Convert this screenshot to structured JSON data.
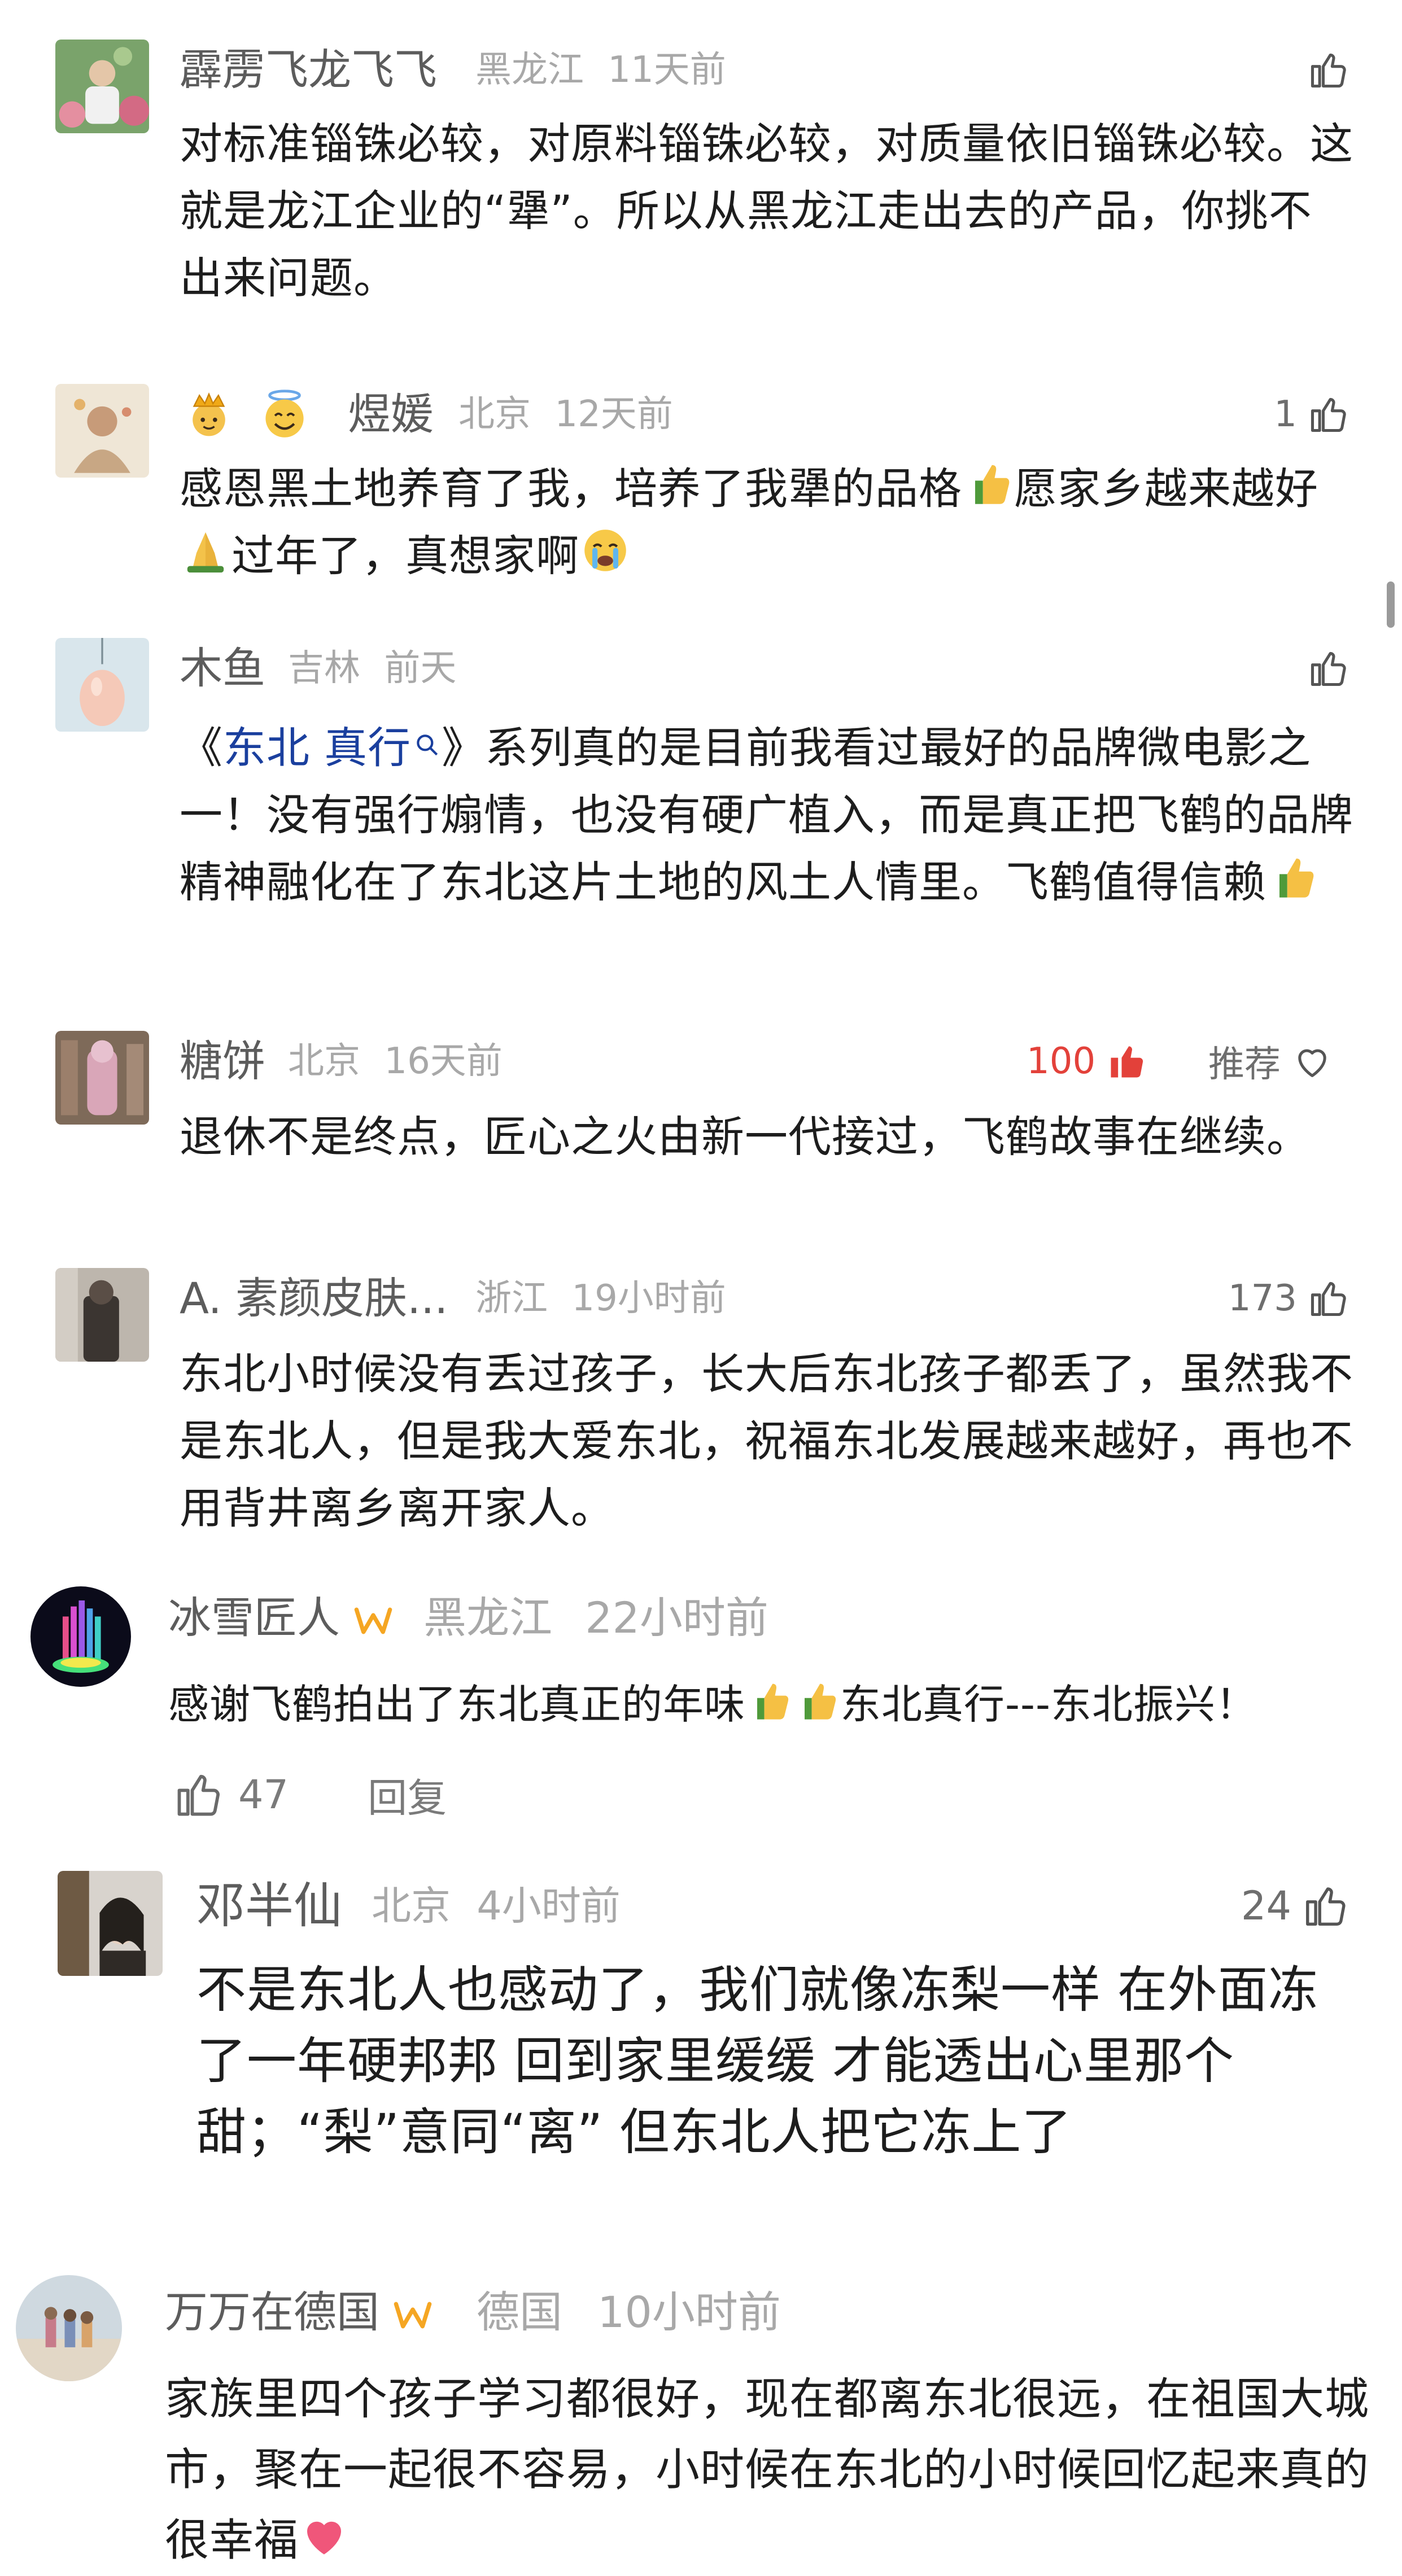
{
  "comments": [
    {
      "name": "霹雳飞龙飞飞",
      "location": "黑龙江",
      "time": "11天前",
      "likes": "",
      "text": "对标准锱铢必较，对原料锱铢必较，对质量依旧锱铢必较。这就是龙江企业的“犟”。所以从黑龙江走出去的产品，你挑不出来问题。"
    },
    {
      "name": "煜媛",
      "location": "北京",
      "time": "12天前",
      "likes": "1",
      "text_a": "感恩黑土地养育了我，培养了我犟的品格",
      "text_b": "愿家乡越来越好",
      "text_c": "过年了，真想家啊"
    },
    {
      "name": "木鱼",
      "location": "吉林",
      "time": "前天",
      "likes": "",
      "quote_open": "《",
      "hashtag": "东北 真行",
      "quote_close": "》",
      "text": "系列真的是目前我看过最好的品牌微电影之一！没有强行煽情，也没有硬广植入，而是真正把飞鹤的品牌精神融化在了东北这片土地的风土人情里。飞鹤值得信赖"
    },
    {
      "name": "糖饼",
      "location": "北京",
      "time": "16天前",
      "likes": "100",
      "recommend": "推荐",
      "text": "退休不是终点，匠心之火由新一代接过，飞鹤故事在继续。"
    },
    {
      "name": "A. 素颜皮肤...",
      "location": "浙江",
      "time": "19小时前",
      "likes": "173",
      "text": "东北小时候没有丢过孩子，长大后东北孩子都丢了，虽然我不是东北人，但是我大爱东北，祝福东北发展越来越好，再也不用背井离乡离开家人。"
    },
    {
      "name": "冰雪匠人",
      "location": "黑龙江",
      "time": "22小时前",
      "text_a": "感谢飞鹤拍出了东北真正的年味",
      "text_b": "东北真行---东北振兴！",
      "likes": "47",
      "reply": "回复"
    },
    {
      "name": "邓半仙",
      "location": "北京",
      "time": "4小时前",
      "likes": "24",
      "text": "不是东北人也感动了，我们就像冻梨一样 在外面冻了一年硬邦邦 回到家里缓缓 才能透出心里那个甜；“梨”意同“离” 但东北人把它冻上了"
    },
    {
      "name": "万万在德国",
      "location": "德国",
      "time": "10小时前",
      "text": "家族里四个孩子学习都很好，现在都离东北很远，在祖国大城市，聚在一起很不容易，小时候在东北的小时候回忆起来真的很幸福"
    }
  ],
  "colors": {
    "name": "#5c5c5c",
    "meta": "#a8a8a8",
    "body": "#1d1d1d",
    "hashtag": "#1a3f9e",
    "like_active": "#e3413a",
    "badge": "#f5a623"
  },
  "icons": [
    "thumb-up-icon",
    "heart-icon",
    "search-icon",
    "verified-badge-icon",
    "reply-like-icon"
  ]
}
